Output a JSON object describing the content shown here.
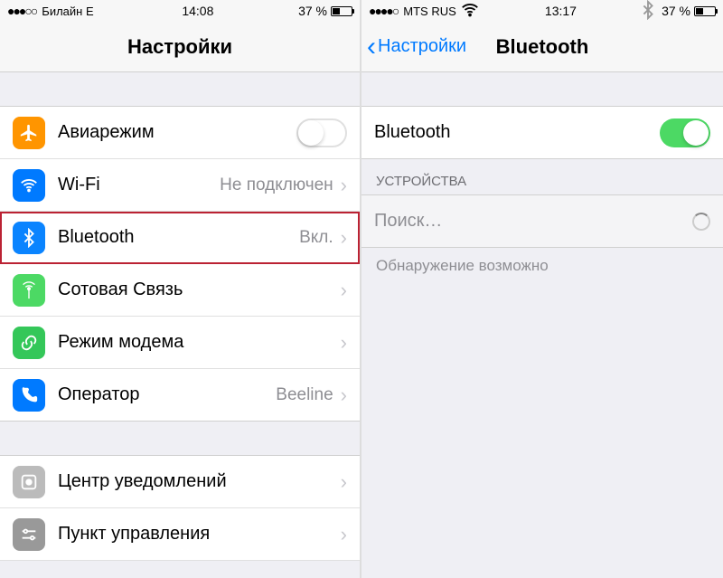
{
  "left": {
    "status": {
      "carrier": "Билайн  E",
      "time": "14:08",
      "battery": "37 %"
    },
    "title": "Настройки",
    "rows": {
      "airplane": "Авиарежим",
      "wifi": {
        "label": "Wi-Fi",
        "value": "Не подключен"
      },
      "bluetooth": {
        "label": "Bluetooth",
        "value": "Вкл."
      },
      "cellular": "Сотовая Связь",
      "hotspot": "Режим модема",
      "carrier": {
        "label": "Оператор",
        "value": "Beeline"
      },
      "notif": "Центр уведомлений",
      "control": "Пункт управления"
    }
  },
  "right": {
    "status": {
      "carrier": "MTS RUS",
      "time": "13:17",
      "battery": "37 %"
    },
    "back": "Настройки",
    "title": "Bluetooth",
    "toggle": "Bluetooth",
    "section": "УСТРОЙСТВА",
    "searching": "Поиск…",
    "discoverable": "Обнаружение возможно"
  }
}
